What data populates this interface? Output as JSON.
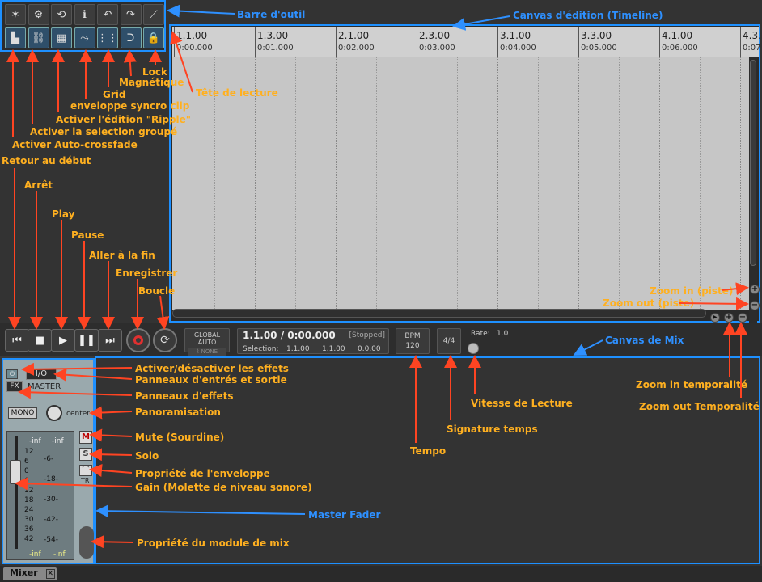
{
  "toolbar": {
    "title": "Barre d'outil",
    "buttons": [
      {
        "icon": "new-item-icon",
        "glyph": "✶"
      },
      {
        "icon": "item-settings-icon",
        "glyph": "⚙"
      },
      {
        "icon": "loop-item-icon",
        "glyph": "⟲"
      },
      {
        "icon": "item-info-icon",
        "glyph": "ℹ"
      },
      {
        "icon": "undo-red-icon",
        "glyph": "↶"
      },
      {
        "icon": "redo-green-icon",
        "glyph": "↷"
      },
      {
        "icon": "ramp-icon",
        "glyph": "⟋"
      },
      {
        "icon": "auto-crossfade-icon",
        "glyph": "▙"
      },
      {
        "icon": "group-selection-icon",
        "glyph": "⛓"
      },
      {
        "icon": "ripple-edit-icon",
        "glyph": "▦"
      },
      {
        "icon": "envelope-sync-icon",
        "glyph": "⤳"
      },
      {
        "icon": "grid-icon",
        "glyph": "⋮⋮"
      },
      {
        "icon": "snap-icon",
        "glyph": "ᑐ"
      },
      {
        "icon": "lock-icon",
        "glyph": "🔒"
      }
    ]
  },
  "timeline": {
    "title": "Canvas d'édition (Timeline)",
    "ticks": [
      {
        "bar": "1.1.00",
        "time": "0:00.000"
      },
      {
        "bar": "1.3.00",
        "time": "0:01.000"
      },
      {
        "bar": "2.1.00",
        "time": "0:02.000"
      },
      {
        "bar": "2.3.00",
        "time": "0:03.000"
      },
      {
        "bar": "3.1.00",
        "time": "0:04.000"
      },
      {
        "bar": "3.3.00",
        "time": "0:05.000"
      },
      {
        "bar": "4.1.00",
        "time": "0:06.000"
      },
      {
        "bar": "4.3.",
        "time": "0:07."
      }
    ]
  },
  "transport": {
    "global_auto": "GLOBAL AUTO",
    "none_label": "NONE",
    "position": "1.1.00 / 0:00.000",
    "status": "[Stopped]",
    "selection_label": "Selection:",
    "selection_start": "1.1.00",
    "selection_end": "1.1.00",
    "selection_length": "0.0.00",
    "bpm_label": "BPM",
    "bpm_value": "120",
    "time_signature": "4/4",
    "rate_label": "Rate:",
    "rate_value": "1.0"
  },
  "mixer": {
    "title": "Canvas de Mix",
    "io_label": "I/O",
    "fx_label": "FX",
    "master_label": "MASTER",
    "mono_label": "MONO",
    "pan_label": "center",
    "mute_label": "M",
    "solo_label": "S",
    "tr_label": "TR",
    "meter_left_peak": "-inf",
    "meter_right_peak": "-inf",
    "meter_scale_left": [
      "12",
      "6",
      "0",
      "6",
      "12",
      "18",
      "24",
      "30",
      "36",
      "42"
    ],
    "meter_scale_mid": [
      "-6-",
      "-18-",
      "-30-",
      "-42-",
      "-54-"
    ],
    "bottom_left": "-inf",
    "bottom_right": "-inf",
    "tab_label": "Mixer"
  },
  "annotations": {
    "toolbar": "Barre d'outil",
    "timeline": "Canvas d'édition (Timeline)",
    "lock": "Lock",
    "snap": "Magnétique",
    "grid": "Grid",
    "env_sync": "enveloppe syncro clip",
    "ripple": "Activer l'édition \"Ripple\"",
    "group_sel": "Activer la selection groupé",
    "auto_xfade": "Activer Auto-crossfade",
    "playhead": "Tête de lecture",
    "go_start": "Retour au début",
    "stop": "Arrêt",
    "play": "Play",
    "pause": "Pause",
    "go_end": "Aller à la fin",
    "record": "Enregistrer",
    "loop": "Boucle",
    "zoom_in_track": "Zoom in (piste)",
    "zoom_out_track": "Zoom out (piste)",
    "mix_canvas": "Canvas de Mix",
    "fx_toggle": "Activer/désactiver les effets",
    "io_panel": "Panneaux d'entrés et sortie",
    "fx_panel": "Panneaux d'effets",
    "pan": "Panoramisation",
    "mute": "Mute (Sourdine)",
    "solo": "Solo",
    "env_prop": "Propriété de l'enveloppe",
    "gain": "Gain (Molette de niveau sonore)",
    "master_fader": "Master Fader",
    "mix_prop": "Propriété du module de mix",
    "tempo": "Tempo",
    "time_sig": "Signature temps",
    "play_rate": "Vitesse de Lecture",
    "zoom_in_time": "Zoom in temporalité",
    "zoom_out_time": "Zoom out Temporalité"
  },
  "colors": {
    "annotation_orange": "#ffb020",
    "annotation_blue": "#2e90ff",
    "arrow_red": "#ff4422",
    "frame_blue": "#1e90ff"
  }
}
